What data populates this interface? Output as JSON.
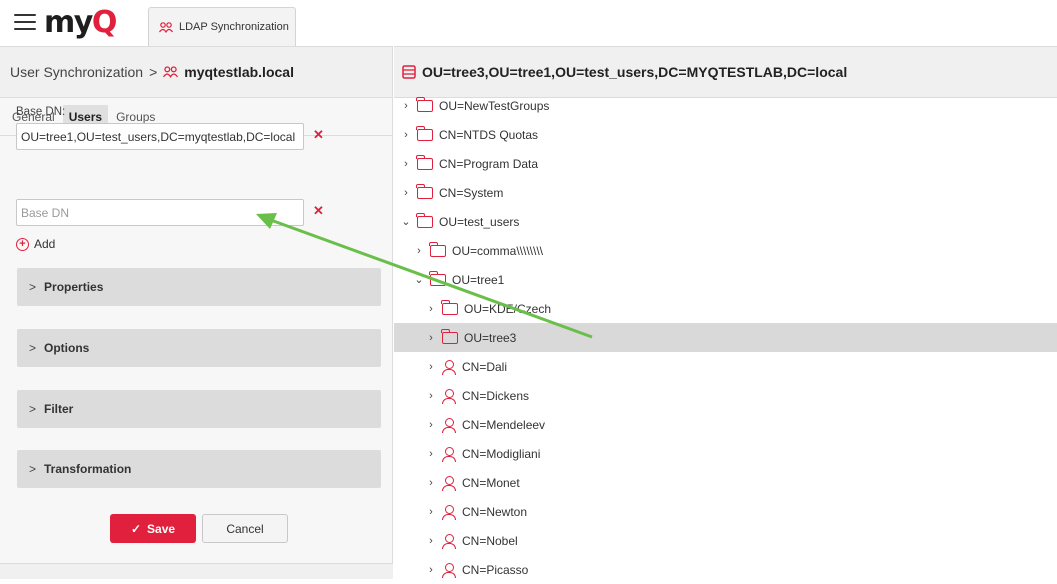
{
  "app": {
    "logo_main": "my",
    "logo_accent": "Q"
  },
  "tab": {
    "label": "LDAP Synchronization",
    "icon": "users-icon"
  },
  "left": {
    "breadcrumb_root": "User Synchronization",
    "breadcrumb_sep": ">",
    "server": "myqtestlab.local",
    "subtabs": [
      "General",
      "Users",
      "Groups"
    ],
    "base_dn_label": "Base DN:",
    "base_dn_value": "OU=tree1,OU=test_users,DC=myqtestlab,DC=local",
    "base_dn_placeholder": "Base DN",
    "add_label": "Add",
    "sections": [
      "Properties",
      "Options",
      "Filter",
      "Transformation"
    ],
    "save_label": "Save",
    "cancel_label": "Cancel"
  },
  "right": {
    "title": "OU=tree3,OU=tree1,OU=test_users,DC=MYQTESTLAB,DC=local",
    "nodes": [
      {
        "label": "OU=NewTestGroups",
        "icon": "folder-icon",
        "expanded": false
      },
      {
        "label": "CN=NTDS Quotas",
        "icon": "folder-icon",
        "expanded": false
      },
      {
        "label": "CN=Program Data",
        "icon": "folder-icon",
        "expanded": false
      },
      {
        "label": "CN=System",
        "icon": "folder-icon",
        "expanded": false
      },
      {
        "label": "OU=test_users",
        "icon": "folder-icon",
        "expanded": true
      },
      {
        "label": "OU=comma\\\\\\\\\\\\\\\\",
        "icon": "folder-icon",
        "expanded": false
      },
      {
        "label": "OU=tree1",
        "icon": "folder-icon",
        "expanded": true
      },
      {
        "label": "OU=KDE/Czech",
        "icon": "folder-icon",
        "expanded": false
      },
      {
        "label": "OU=tree3",
        "icon": "folder-icon",
        "expanded": false,
        "selected": true
      },
      {
        "label": "CN=Dali",
        "icon": "user-icon",
        "expanded": false
      },
      {
        "label": "CN=Dickens",
        "icon": "user-icon",
        "expanded": false
      },
      {
        "label": "CN=Mendeleev",
        "icon": "user-icon",
        "expanded": false
      },
      {
        "label": "CN=Modigliani",
        "icon": "user-icon",
        "expanded": false
      },
      {
        "label": "CN=Monet",
        "icon": "user-icon",
        "expanded": false
      },
      {
        "label": "CN=Newton",
        "icon": "user-icon",
        "expanded": false
      },
      {
        "label": "CN=Nobel",
        "icon": "user-icon",
        "expanded": false
      },
      {
        "label": "CN=Picasso",
        "icon": "user-icon",
        "expanded": false
      }
    ]
  },
  "colors": {
    "accent": "#e0203c",
    "annotation_arrow": "#6abf4b"
  }
}
